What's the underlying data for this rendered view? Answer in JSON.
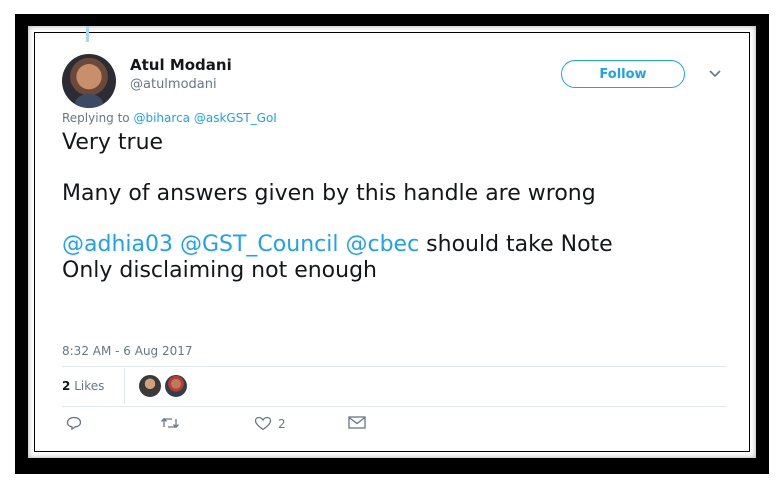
{
  "author": {
    "name": "Atul Modani",
    "handle": "@atulmodani",
    "follow_label": "Follow"
  },
  "reply": {
    "prefix": "Replying to",
    "mentions": [
      "@biharca",
      "@askGST_GoI"
    ]
  },
  "tweet": {
    "line1": "Very true",
    "line2": "Many of answers given by this handle are wrong",
    "mention1": "@adhia03",
    "mention2": "@GST_Council",
    "mention3": "@cbec",
    "line3_rest": "should take Note",
    "line4": "Only disclaiming not enough"
  },
  "timestamp": "8:32 AM - 6 Aug 2017",
  "likes": {
    "count": "2",
    "label": "Likes"
  },
  "actions": {
    "like_count": "2"
  },
  "colors": {
    "accent": "#1da1f2",
    "text": "#14171a",
    "muted": "#657786",
    "frame": "#000000"
  },
  "icons": [
    "chevron-down-icon",
    "reply-icon",
    "retweet-icon",
    "heart-icon",
    "envelope-icon"
  ]
}
